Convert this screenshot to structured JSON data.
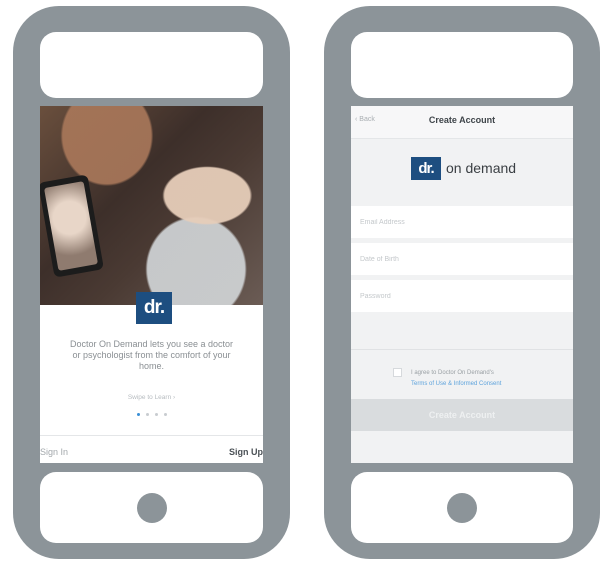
{
  "left_phone": {
    "tagline": "Doctor On Demand lets you see a doctor or psychologist from the comfort of your home.",
    "logo_text": "dr.",
    "swipe_hint": "Swipe to Learn ›",
    "dots": [
      true,
      false,
      false,
      false
    ],
    "sign_in": "Sign In",
    "sign_up": "Sign Up"
  },
  "right_phone": {
    "back": "‹ Back",
    "title": "Create Account",
    "brand_logo": "dr.",
    "brand_name": "on demand",
    "email_placeholder": "Email Address",
    "dob_placeholder": "Date of Birth",
    "password_placeholder": "Password",
    "consent_prefix": "I agree to Doctor On Demand's",
    "consent_link": "Terms of Use & Informed Consent",
    "create_button": "Create Account"
  },
  "colors": {
    "bezel": "#8c9499",
    "brand_blue": "#1d4e80",
    "link_blue": "#5da3dc",
    "active_dot": "#3a8fd6"
  }
}
